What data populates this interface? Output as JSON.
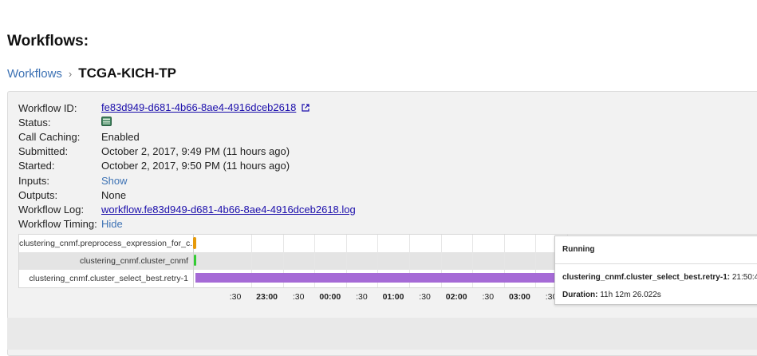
{
  "page": {
    "title": "Workflows:"
  },
  "breadcrumb": {
    "link": "Workflows",
    "separator": "›",
    "current": "TCGA-KICH-TP"
  },
  "details": {
    "rows": [
      {
        "label": "Workflow ID:",
        "value": "fe83d949-d681-4b66-8ae4-4916dceb2618",
        "type": "link-external"
      },
      {
        "label": "Status:",
        "value": "",
        "type": "status-icon"
      },
      {
        "label": "Call Caching:",
        "value": "Enabled",
        "type": "text"
      },
      {
        "label": "Submitted:",
        "value": "October 2, 2017, 9:49 PM (11 hours ago)",
        "type": "text"
      },
      {
        "label": "Started:",
        "value": "October 2, 2017, 9:50 PM (11 hours ago)",
        "type": "text"
      },
      {
        "label": "Inputs:",
        "value": "Show",
        "type": "toggle"
      },
      {
        "label": "Outputs:",
        "value": "None",
        "type": "text"
      },
      {
        "label": "Workflow Log:",
        "value": "workflow.fe83d949-d681-4b66-8ae4-4916dceb2618.log",
        "type": "link"
      },
      {
        "label": "Workflow Timing:",
        "value": "Hide",
        "type": "toggle"
      }
    ]
  },
  "timing": {
    "tasks": [
      {
        "name": "clustering_cnmf.preprocess_expression_for_c...",
        "color": "#e69a0a"
      },
      {
        "name": "clustering_cnmf.cluster_cnmf",
        "color": "#33cc33"
      },
      {
        "name": "clustering_cnmf.cluster_select_best.retry-1",
        "color": "#a56ad6"
      }
    ],
    "ticks": [
      {
        "label": ":30",
        "bold": false
      },
      {
        "label": "23:00",
        "bold": true
      },
      {
        "label": ":30",
        "bold": false
      },
      {
        "label": "00:00",
        "bold": true
      },
      {
        "label": ":30",
        "bold": false
      },
      {
        "label": "01:00",
        "bold": true
      },
      {
        "label": ":30",
        "bold": false
      },
      {
        "label": "02:00",
        "bold": true
      },
      {
        "label": ":30",
        "bold": false
      },
      {
        "label": "03:00",
        "bold": true
      },
      {
        "label": ":30",
        "bold": false
      }
    ],
    "tooltip": {
      "status": "Running",
      "task_name": "clustering_cnmf.cluster_select_best.retry-1:",
      "task_time": "21:50:4",
      "duration_label": "Duration:",
      "duration_value": "11h 12m 26.022s"
    }
  },
  "colors": {
    "link": "#3d72b4",
    "status_icon": "#3b7f5a"
  }
}
